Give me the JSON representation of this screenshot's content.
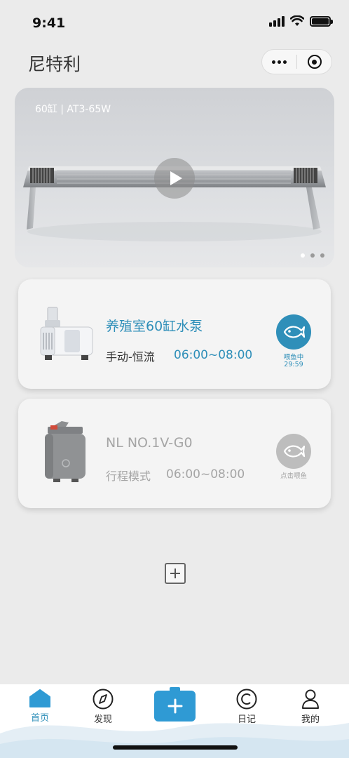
{
  "status_bar": {
    "time": "9:41"
  },
  "header": {
    "title": "尼特利"
  },
  "banner": {
    "caption": "60缸 | AT3-65W",
    "slides": 3,
    "active_slide": 1
  },
  "devices": [
    {
      "name": "养殖室60缸水泵",
      "mode": "手动-恒流",
      "schedule": "06:00~08:00",
      "feed_status": "喂鱼中",
      "feed_countdown": "29:59",
      "online": true
    },
    {
      "name": "NL NO.1V-G0",
      "mode": "行程模式",
      "schedule": "06:00~08:00",
      "feed_status": "点击喂鱼",
      "online": false
    }
  ],
  "tabbar": {
    "home": "首页",
    "discover": "发现",
    "diary": "日记",
    "mine": "我的"
  },
  "colors": {
    "accent": "#2f8fb9",
    "add_button": "#2f9ad4",
    "inactive": "#a5a5a5",
    "background": "#ebebeb"
  }
}
